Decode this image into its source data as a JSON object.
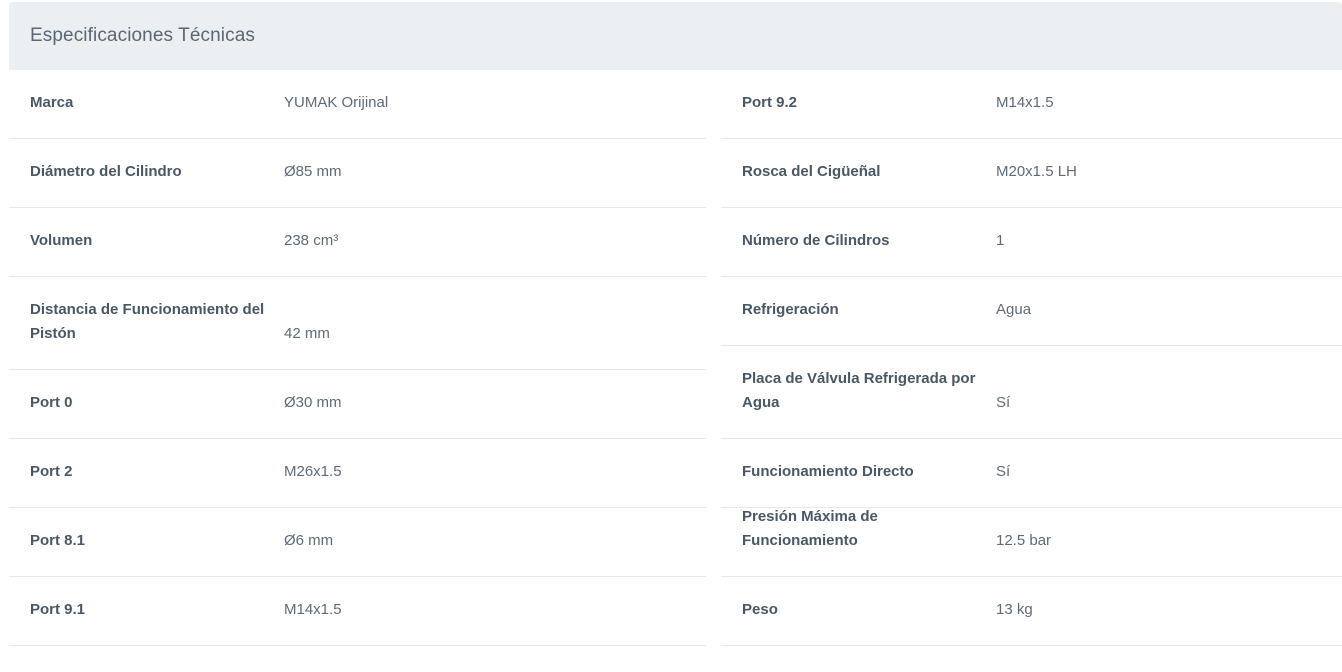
{
  "header": {
    "title": "Especificaciones Técnicas"
  },
  "left_rows": [
    {
      "label": "Marca",
      "value": "YUMAK Orijinal"
    },
    {
      "label": "Diámetro del Cilindro",
      "value": "Ø85 mm"
    },
    {
      "label": "Volumen",
      "value": "238 cm³"
    },
    {
      "label": "Distancia de Funcionamiento del Pistón",
      "value": "42 mm"
    },
    {
      "label": "Port 0",
      "value": "Ø30 mm"
    },
    {
      "label": "Port 2",
      "value": "M26x1.5"
    },
    {
      "label": "Port 8.1",
      "value": "Ø6 mm"
    },
    {
      "label": "Port 9.1",
      "value": "M14x1.5"
    }
  ],
  "right_rows": [
    {
      "label": "Port 9.2",
      "value": "M14x1.5"
    },
    {
      "label": "Rosca del Cigüeñal",
      "value": "M20x1.5 LH"
    },
    {
      "label": "Número de Cilindros",
      "value": "1"
    },
    {
      "label": "Refrigeración",
      "value": "Agua"
    },
    {
      "label": "Placa de Válvula Refrigerada por Agua",
      "value": "Sí"
    },
    {
      "label": "Funcionamiento Directo",
      "value": "Sí"
    },
    {
      "label": "Presión Máxima de Funcionamiento",
      "value": "12.5 bar"
    },
    {
      "label": "Peso",
      "value": "13 kg"
    }
  ]
}
